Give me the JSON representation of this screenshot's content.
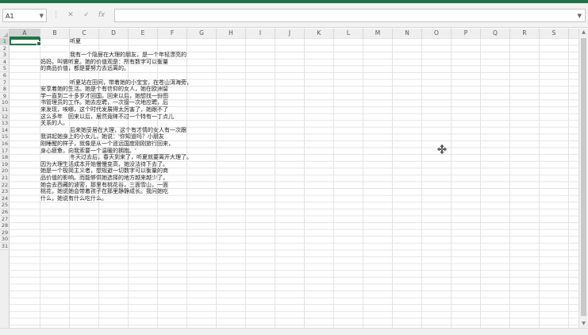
{
  "namebox": {
    "value": "A1"
  },
  "formula_bar": {
    "value": ""
  },
  "column_headers": [
    "A",
    "B",
    "C",
    "D",
    "E",
    "F",
    "G",
    "H",
    "I",
    "J",
    "K",
    "L",
    "M",
    "N",
    "O",
    "P",
    "Q",
    "R",
    "S"
  ],
  "row_count": 31,
  "selected_cell": "A1",
  "colors": {
    "accent": "#217346",
    "gridline": "#e3e3e3",
    "header_bg": "#efefef"
  },
  "icons": [
    "cancel-icon",
    "check-icon",
    "function-icon",
    "cursor-move-icon"
  ],
  "cells": [
    {
      "row": 1,
      "text": "听夏"
    },
    {
      "row": 3,
      "text": "我有一个隐居在大理的朋友，是一个年轻漂亮的"
    },
    {
      "row": 4,
      "text": "妈妈，叫做听夏。她的价值观是：所有数字可以衡量"
    },
    {
      "row": 5,
      "text": "的商品价值，都是要努力去远离的。"
    },
    {
      "row": 7,
      "text": "听夏站在田间，带着她的小宝宝，在苍山洱海旁，"
    },
    {
      "row": 8,
      "text": "安享着她的生活。她是个有信仰的女人，她在欧洲留"
    },
    {
      "row": 9,
      "text": "学一直到二十多岁才回国。回来以后，她想找一份图"
    },
    {
      "row": 10,
      "text": "书管理员的工作。她去应聘，一次接一次地应聘，后"
    },
    {
      "row": 11,
      "text": "来发现，唉哪，这个时代发展得太厉害了，她跟不了"
    },
    {
      "row": 12,
      "text": "这么多年　回来以后，居然竟睐不过一个特有一丁点儿"
    },
    {
      "row": 13,
      "text": "关系的人。"
    },
    {
      "row": 14,
      "text": "后来她妥居在大理，这个有才情的女人有一次跟"
    },
    {
      "row": 15,
      "text": "我讲起她身上的小女儿，她说：'你知道吗？小朋友"
    },
    {
      "row": 16,
      "text": "刚睡醒的样子，就像是从一个遥远国度刚刚旅行回来，"
    },
    {
      "row": 17,
      "text": "身心疲惫，向我索要一个温暖的拥抱。'"
    },
    {
      "row": 18,
      "text": "冬天过去后，春天到来了，听夏就要离开大理了。"
    },
    {
      "row": 19,
      "text": "因为大理生活成本开始慢慢变高，她没法待下去了。"
    },
    {
      "row": 20,
      "text": "她是一个极简主义者，想规避一切数字可以衡量的商"
    },
    {
      "row": 21,
      "text": "品价值的影响。而能够供她选择的地方越来越少了，"
    },
    {
      "row": 22,
      "text": "她会去西藏的波密，那里有桃花谷，三面雪山，一面"
    },
    {
      "row": 23,
      "text": "桃花，她说她会带着孩子在那里静静成长。我问她吃"
    },
    {
      "row": 24,
      "text": "什么，她说有什么吃什么。"
    }
  ]
}
